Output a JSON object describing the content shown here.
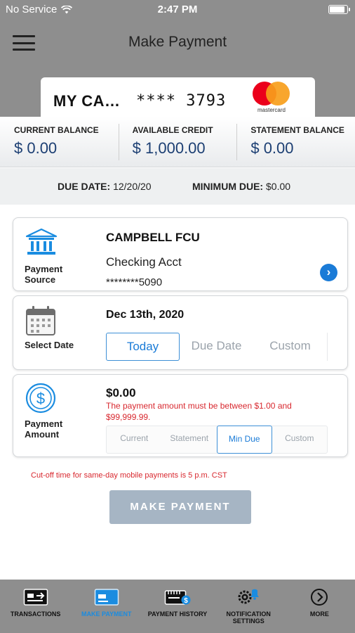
{
  "status_bar": {
    "carrier": "No Service",
    "time": "2:47 PM",
    "battery_level": 0.9
  },
  "nav": {
    "title": "Make Payment",
    "menu_icon": "hamburger-menu-icon"
  },
  "card": {
    "name": "MY CA…",
    "number": "**** 3793",
    "network_logo": "mastercard",
    "network_text": "mastercard",
    "logo_colors": {
      "red": "#eb001b",
      "orange": "#f79e1b"
    }
  },
  "balances": [
    {
      "label": "CURRENT BALANCE",
      "value": "$ 0.00"
    },
    {
      "label": "AVAILABLE CREDIT",
      "value": "$ 1,000.00"
    },
    {
      "label": "STATEMENT BALANCE",
      "value": "$ 0.00"
    }
  ],
  "due": {
    "due_date_label": "DUE DATE:",
    "due_date_value": "12/20/20",
    "min_due_label": "MINIMUM DUE:",
    "min_due_value": "$0.00"
  },
  "payment_source": {
    "label_line1": "Payment",
    "label_line2": "Source",
    "icon": "bank-icon",
    "bank_name": "CAMPBELL FCU",
    "account_type": "Checking Acct",
    "account_number": "********5090",
    "chevron": "›"
  },
  "select_date": {
    "label": "Select Date",
    "icon": "calendar-icon",
    "date_value": "Dec 13th, 2020",
    "options": [
      "Today",
      "Due Date",
      "Custom"
    ],
    "selected": "Today"
  },
  "payment_amount": {
    "label_line1": "Payment",
    "label_line2": "Amount",
    "icon": "dollar-circle-icon",
    "amount": "$0.00",
    "error": "The payment amount must be between $1.00 and $99,999.99.",
    "options": [
      "Current",
      "Statement",
      "Min Due",
      "Custom"
    ],
    "selected": "Min Due"
  },
  "cutoff_notice": "Cut-off time for same-day mobile payments is 5 p.m. CST",
  "make_payment_button": "MAKE PAYMENT",
  "tab_bar": [
    {
      "label": "TRANSACTIONS",
      "icon": "transactions-icon",
      "active": false
    },
    {
      "label": "MAKE PAYMENT",
      "icon": "card-payment-icon",
      "active": true
    },
    {
      "label": "PAYMENT HISTORY",
      "icon": "payment-history-icon",
      "active": false
    },
    {
      "label": "NOTIFICATION SETTINGS",
      "icon": "notification-settings-icon",
      "active": false
    },
    {
      "label": "MORE",
      "icon": "more-chevron-icon",
      "active": false
    }
  ],
  "colors": {
    "header_gray": "#8e8e8e",
    "balance_blue": "#1c3f73",
    "accent_blue": "#1a7bd7",
    "error_red": "#d8282f",
    "disabled_button": "#a6b5c4"
  }
}
